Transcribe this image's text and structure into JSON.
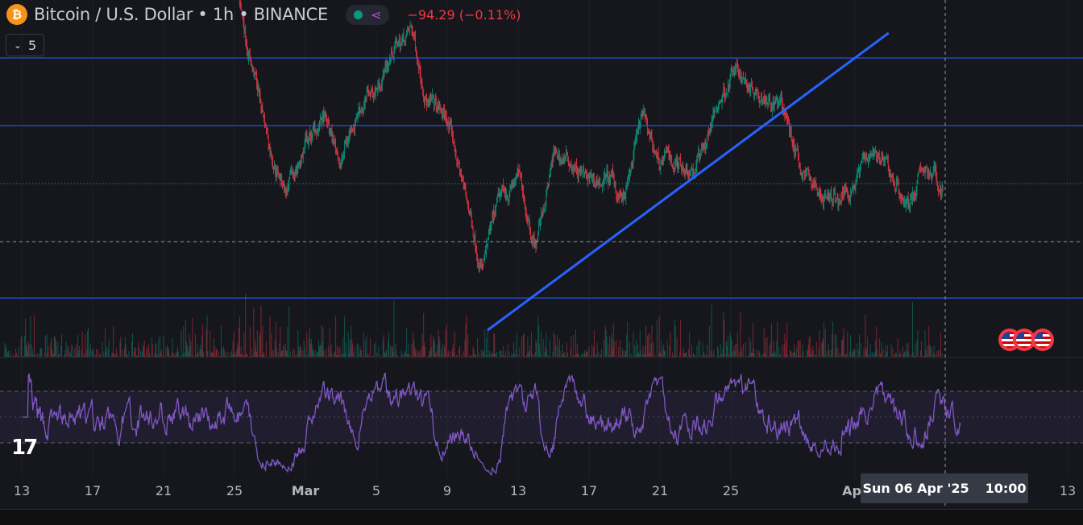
{
  "header": {
    "symbol": "Bitcoin / U.S. Dollar • 1h • BINANCE",
    "logo_glyph": "₿",
    "change": "−94.29 (−0.11%)",
    "change_color": "#f23645",
    "status_color": "#089981"
  },
  "indicators_toggle": {
    "count": "5"
  },
  "crosshair_label": {
    "date": "Sun 06 Apr '25",
    "time": "10:00"
  },
  "tv_logo": "TV",
  "events": [
    "US event",
    "US event",
    "US event"
  ],
  "colors": {
    "up": "#089981",
    "down": "#f23645",
    "line": "#2962ff",
    "rsi": "#7e57c2"
  },
  "chart_data": {
    "type": "candlestick",
    "timeframe": "1h",
    "x_ticks": [
      {
        "label": "13",
        "day": 1
      },
      {
        "label": "17",
        "day": 5
      },
      {
        "label": "21",
        "day": 9
      },
      {
        "label": "25",
        "day": 13
      },
      {
        "label": "Mar",
        "day": 17,
        "bold": true
      },
      {
        "label": "5",
        "day": 21
      },
      {
        "label": "9",
        "day": 25
      },
      {
        "label": "13",
        "day": 29
      },
      {
        "label": "17",
        "day": 33
      },
      {
        "label": "21",
        "day": 37
      },
      {
        "label": "25",
        "day": 41
      },
      {
        "label": "Apr",
        "day": 48,
        "bold": true
      },
      {
        "label": "13",
        "day": 60
      }
    ],
    "day0": "2025-02-12",
    "daily_close": [
      97500,
      97500,
      97500,
      97500,
      97500,
      97500,
      97500,
      97500,
      97500,
      97500,
      97500,
      97500,
      97500,
      97000,
      92400,
      87800,
      85000,
      87800,
      89200,
      86900,
      90100,
      91000,
      93300,
      94200,
      90100,
      89200,
      85100,
      81000,
      84600,
      86000,
      82400,
      87100,
      86900,
      85500,
      86000,
      84600,
      89200,
      86900,
      86900,
      86700,
      89200,
      91900,
      91500,
      91000,
      89600,
      86500,
      85100,
      84600,
      86000,
      87800,
      86000,
      84600,
      86500,
      85300
    ],
    "horizontal_lines": [
      92730,
      88910,
      79180
    ],
    "dashed_level": 82360,
    "last_price": 85640,
    "trend_line": {
      "from": {
        "date": "Mar 11",
        "price": 77360
      },
      "to": {
        "date": "Apr 2",
        "price": 94140
      }
    },
    "rsi": {
      "period": 14,
      "levels": [
        70,
        50,
        30
      ]
    },
    "price_range": [
      76000,
      96000
    ]
  }
}
